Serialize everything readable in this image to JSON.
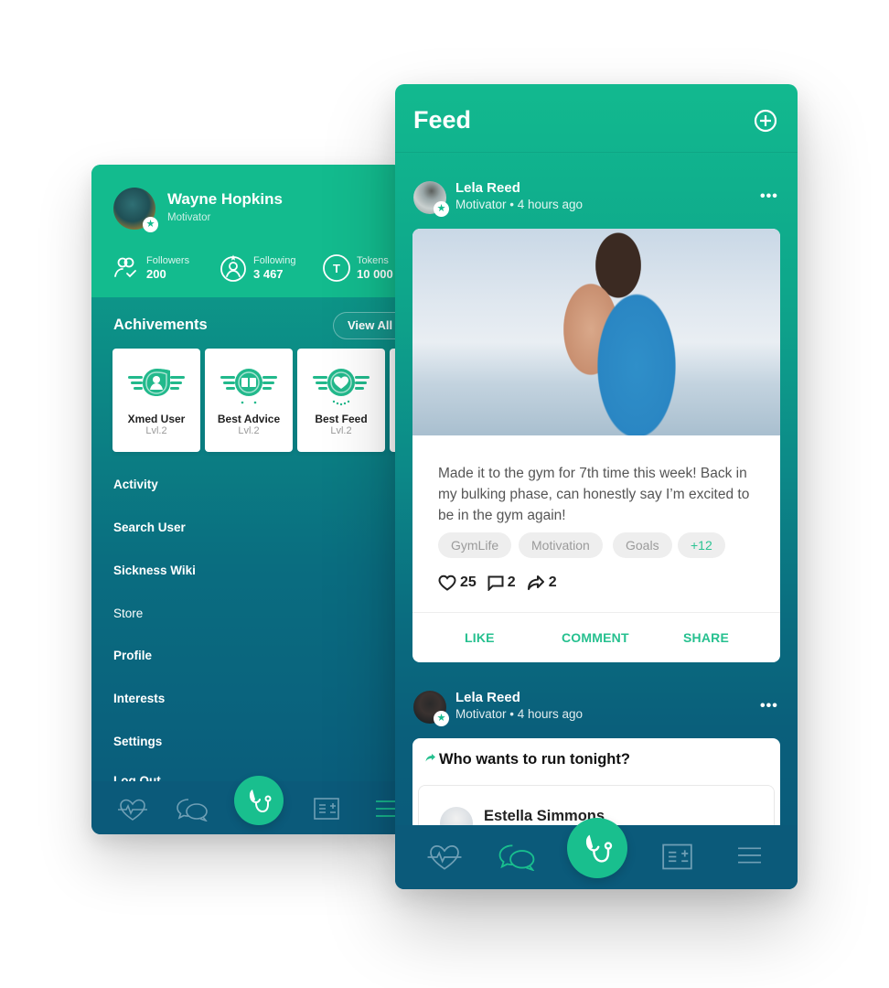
{
  "menu_screen": {
    "user": {
      "name": "Wayne Hopkins",
      "role": "Motivator",
      "badge_icon": "star-icon"
    },
    "stats": [
      {
        "label": "Followers",
        "value": "200",
        "icon": "followers-icon"
      },
      {
        "label": "Following",
        "value": "3 467",
        "icon": "following-icon"
      },
      {
        "label": "Tokens",
        "value": "10 000",
        "icon": "token-icon"
      }
    ],
    "achievements": {
      "title": "Achivements",
      "view_all_label": "View All",
      "items": [
        {
          "title": "Xmed User",
          "level": "Lvl.2",
          "icon": "user-badge-icon"
        },
        {
          "title": "Best Advice",
          "level": "Lvl.2",
          "icon": "advice-badge-icon"
        },
        {
          "title": "Best Feed",
          "level": "Lvl.2",
          "icon": "heart-badge-icon"
        }
      ]
    },
    "menu_items": [
      {
        "label": "Activity"
      },
      {
        "label": "Search User"
      },
      {
        "label": "Sickness Wiki"
      },
      {
        "label": "Store"
      },
      {
        "label": "Profile"
      },
      {
        "label": "Interests"
      },
      {
        "label": "Settings"
      },
      {
        "label": "Log Out"
      }
    ],
    "tabbar": [
      "heart-rate-icon",
      "chat-icon",
      "stethoscope-icon",
      "records-icon",
      "menu-icon"
    ],
    "active_tab": "menu-icon"
  },
  "feed_screen": {
    "title": "Feed",
    "add_icon": "plus-circle-icon",
    "posts": [
      {
        "author": "Lela Reed",
        "meta": "Motivator • 4 hours ago",
        "text": "Made it to the gym for 7th time this week! Back in my bulking phase, can honestly say I’m excited to be in the gym again!",
        "tags": [
          "GymLife",
          "Motivation",
          "Goals"
        ],
        "more_tags": "+12",
        "likes": "25",
        "comments": "2",
        "shares": "2",
        "actions": {
          "like": "LIKE",
          "comment": "COMMENT",
          "share": "SHARE"
        }
      },
      {
        "author": "Lela Reed",
        "meta": "Motivator • 4 hours ago",
        "shared_title": "Who wants to run tonight?",
        "shared_author": "Estella Simmons"
      }
    ],
    "tabbar": [
      "heart-rate-icon",
      "chat-icon",
      "stethoscope-icon",
      "records-icon",
      "menu-icon"
    ],
    "active_tab": "chat-icon"
  },
  "colors": {
    "accent": "#19bf8e",
    "header_green": "#13bb8e",
    "tabbar_blue": "#0b5a7a",
    "action_text": "#26c08f"
  }
}
